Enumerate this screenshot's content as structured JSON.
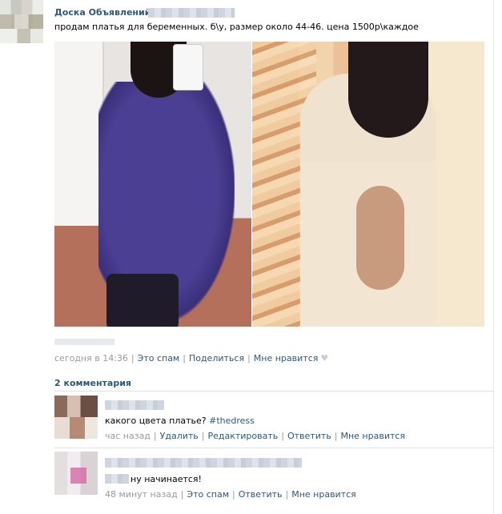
{
  "post": {
    "group_name": "Доска Объявлений,",
    "text": "продам платья для беременных. б\\у, размер около 44-46. цена 1500р\\каждое",
    "time": "сегодня в 14:36",
    "actions": [
      "Это спам",
      "Поделиться",
      "Мне нравится"
    ]
  },
  "comments": {
    "title": "2 комментария",
    "items": [
      {
        "text": "какого цвета платье?",
        "hashtag": "#thedress",
        "time": "час назад",
        "actions": [
          "Удалить",
          "Редактировать",
          "Ответить",
          "Мне нравится"
        ]
      },
      {
        "text": "ну начинается!",
        "time": "48 минут назад",
        "actions": [
          "Это спам",
          "Ответить",
          "Мне нравится"
        ]
      }
    ]
  },
  "icons": {
    "like": "heart-icon"
  },
  "colors": {
    "link": "#2b587a",
    "meta": "#999999",
    "rule": "#dbe2e8"
  }
}
